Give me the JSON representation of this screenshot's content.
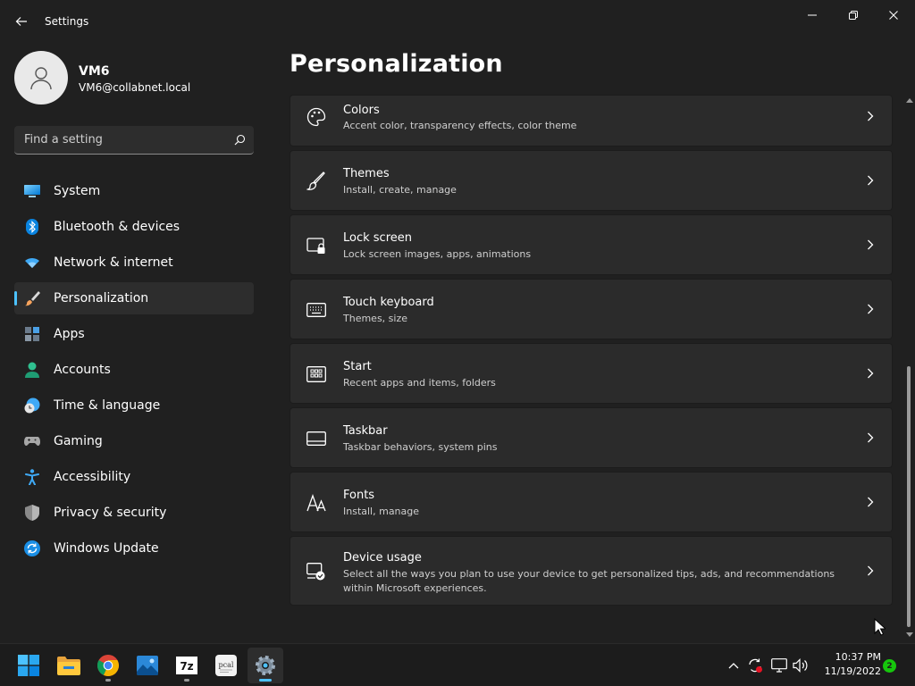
{
  "window": {
    "title": "Settings"
  },
  "profile": {
    "name": "VM6",
    "email": "VM6@collabnet.local"
  },
  "search": {
    "placeholder": "Find a setting"
  },
  "nav": {
    "items": [
      {
        "label": "System",
        "icon": "system-icon"
      },
      {
        "label": "Bluetooth & devices",
        "icon": "bluetooth-icon"
      },
      {
        "label": "Network & internet",
        "icon": "wifi-icon"
      },
      {
        "label": "Personalization",
        "icon": "brush-icon",
        "active": true
      },
      {
        "label": "Apps",
        "icon": "apps-icon"
      },
      {
        "label": "Accounts",
        "icon": "accounts-icon"
      },
      {
        "label": "Time & language",
        "icon": "clock-globe-icon"
      },
      {
        "label": "Gaming",
        "icon": "gamepad-icon"
      },
      {
        "label": "Accessibility",
        "icon": "accessibility-icon"
      },
      {
        "label": "Privacy & security",
        "icon": "shield-icon"
      },
      {
        "label": "Windows Update",
        "icon": "update-icon"
      }
    ]
  },
  "page": {
    "title": "Personalization"
  },
  "cards": [
    {
      "title": "Colors",
      "subtitle": "Accent color, transparency effects, color theme",
      "icon": "palette-icon"
    },
    {
      "title": "Themes",
      "subtitle": "Install, create, manage",
      "icon": "brush-icon"
    },
    {
      "title": "Lock screen",
      "subtitle": "Lock screen images, apps, animations",
      "icon": "lock-screen-icon"
    },
    {
      "title": "Touch keyboard",
      "subtitle": "Themes, size",
      "icon": "keyboard-icon"
    },
    {
      "title": "Start",
      "subtitle": "Recent apps and items, folders",
      "icon": "start-icon"
    },
    {
      "title": "Taskbar",
      "subtitle": "Taskbar behaviors, system pins",
      "icon": "taskbar-icon"
    },
    {
      "title": "Fonts",
      "subtitle": "Install, manage",
      "icon": "fonts-icon"
    },
    {
      "title": "Device usage",
      "subtitle": "Select all the ways you plan to use your device to get personalized tips, ads, and recommendations within Microsoft experiences.",
      "icon": "device-usage-icon"
    }
  ],
  "taskbar": {
    "apps": [
      {
        "name": "start",
        "icon": "windows-start-icon"
      },
      {
        "name": "file-explorer",
        "icon": "folder-icon"
      },
      {
        "name": "chrome",
        "icon": "chrome-icon"
      },
      {
        "name": "photos",
        "icon": "photos-icon"
      },
      {
        "name": "7zip",
        "icon": "seven-zip-icon",
        "label": "7z"
      },
      {
        "name": "pcal",
        "icon": "pcal-icon",
        "label": "pcal"
      },
      {
        "name": "settings",
        "icon": "gear-icon",
        "active": true
      }
    ],
    "clock": {
      "time": "10:37 PM",
      "date": "11/19/2022"
    },
    "notifications": "2"
  },
  "colors": {
    "accent": "#4cc2ff",
    "background": "#202020",
    "card": "#2b2b2b",
    "taskbar": "#1c1c1c"
  }
}
